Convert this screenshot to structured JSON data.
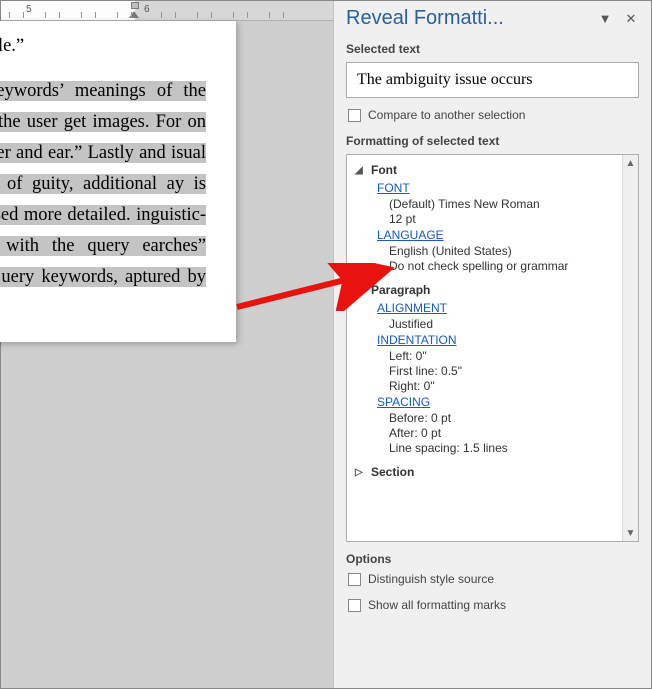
{
  "ruler": {
    "label5": "5",
    "label6": "6"
  },
  "document": {
    "first_line": "rd “apple.”",
    "body": "uery keywords’ meanings of the econd, the user get images. For on character and ear.” Lastly and isual content of guity, additional ay is text based more detailed. inguistic-related with the query earches” feature uery keywords, aptured by these"
  },
  "pane": {
    "title": "Reveal Formatti...",
    "selected_text_label": "Selected text",
    "selected_text_value": "The ambiguity issue occurs",
    "compare_label": "Compare to another selection",
    "formatting_label": "Formatting of selected text",
    "tree": {
      "font": {
        "head": "Font",
        "font_link": "FONT",
        "font_val1": "(Default) Times New Roman",
        "font_val2": "12 pt",
        "lang_link": "LANGUAGE",
        "lang_val1": "English (United States)",
        "lang_val2": "Do not check spelling or grammar"
      },
      "paragraph": {
        "head": "Paragraph",
        "align_link": "ALIGNMENT",
        "align_val": "Justified",
        "indent_link": "INDENTATION",
        "indent_left": "Left:  0\"",
        "indent_first": "First line:  0.5\"",
        "indent_right": "Right:  0\"",
        "spacing_link": "SPACING",
        "sp_before": "Before:  0 pt",
        "sp_after": "After:  0 pt",
        "sp_line": "Line spacing:  1.5 lines"
      },
      "section": {
        "head": "Section"
      }
    },
    "options": {
      "label": "Options",
      "distinguish": "Distinguish style source",
      "show_all": "Show all formatting marks"
    }
  }
}
